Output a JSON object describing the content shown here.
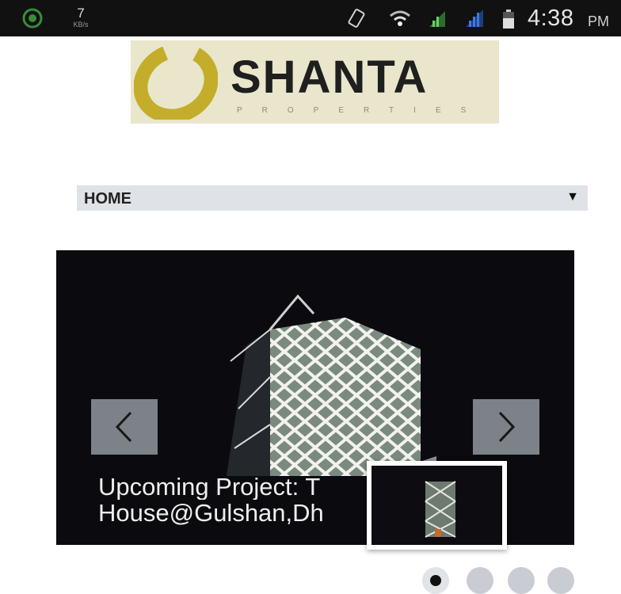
{
  "status_bar": {
    "net_speed_value": "7",
    "net_speed_unit": "KB/s",
    "time": "4:38",
    "ampm": "PM",
    "icons": [
      "app-badge-icon",
      "screen-rotate-icon",
      "wifi-icon",
      "signal-icon",
      "signal-icon",
      "battery-icon"
    ]
  },
  "logo": {
    "name": "SHANTA",
    "subtitle": "PROPERTIES"
  },
  "nav_menu": {
    "selected": "HOME",
    "caret": "▼"
  },
  "slider": {
    "caption_line1": "Upcoming Project: T",
    "caption_line2": "House@Gulshan,Dh",
    "prev_icon": "chevron-left-icon",
    "next_icon": "chevron-right-icon",
    "slide_count": 4,
    "active_index": 0
  },
  "colors": {
    "status_bar_bg": "#111111",
    "logo_bg": "#e9e6cc",
    "logo_mark": "#c4ad2b",
    "slider_bg": "#0b0b0f",
    "dropdown_bg": "#dfe2e6"
  }
}
